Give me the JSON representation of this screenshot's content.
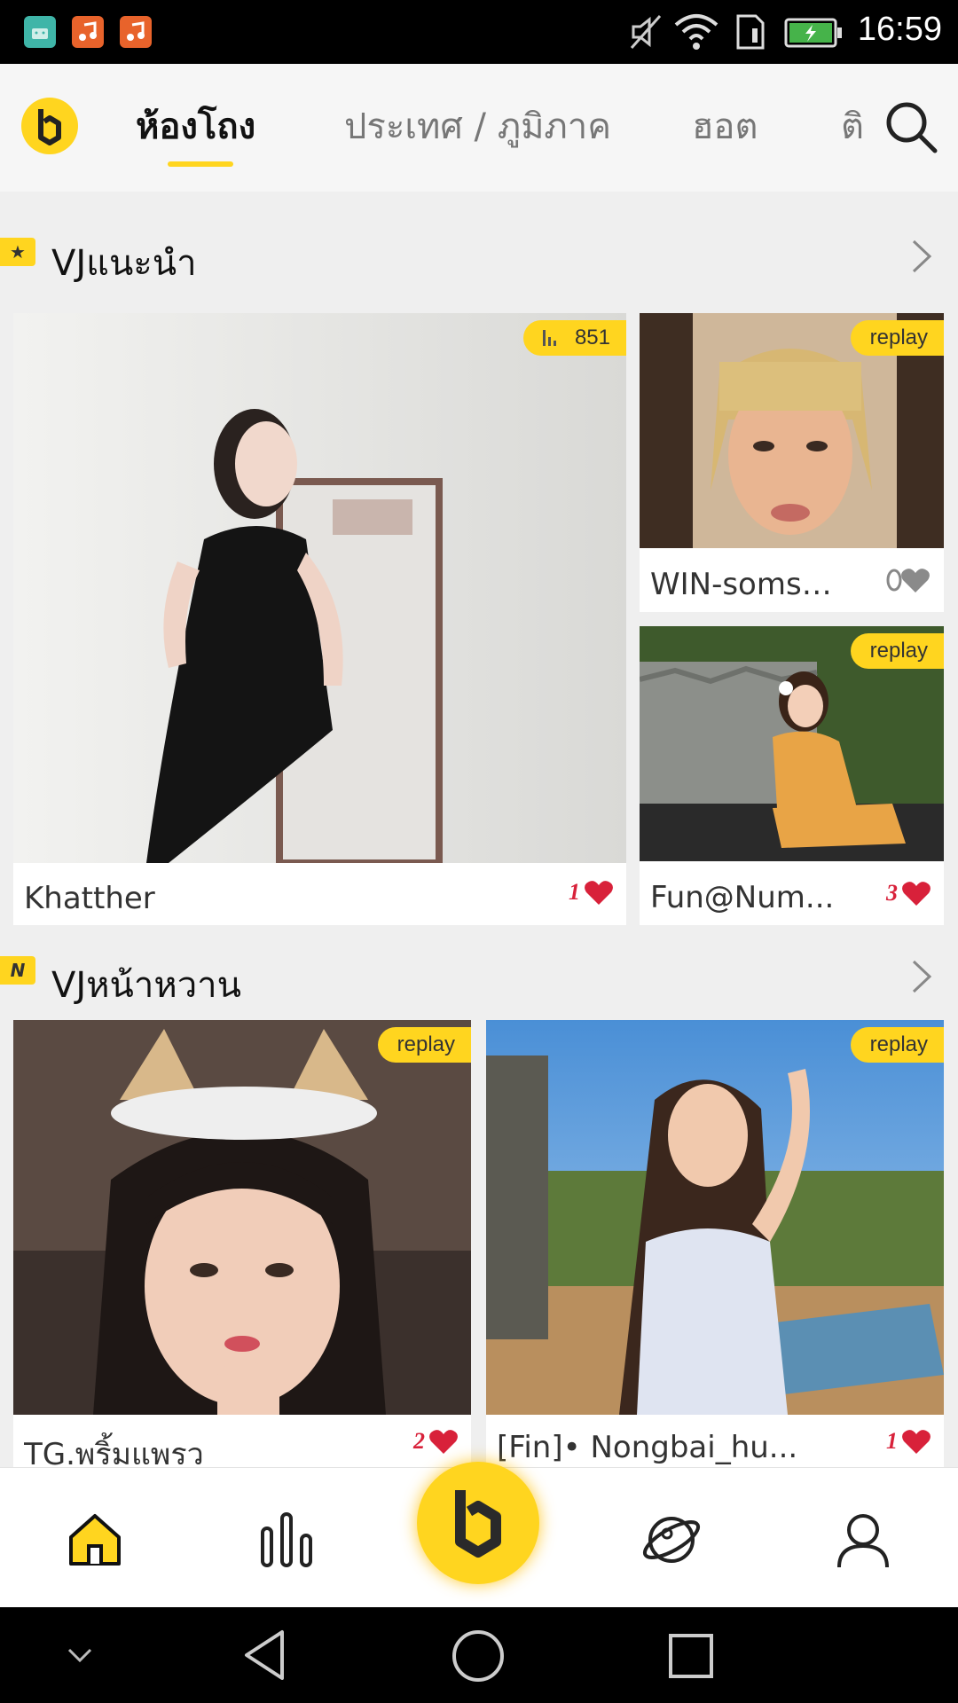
{
  "status_bar": {
    "time": "16:59",
    "app_icons": [
      "android-app-icon",
      "music-app-icon",
      "music-app-icon"
    ],
    "colors": {
      "android": "#3fb5a8",
      "music1": "#e8632b",
      "music2": "#e8632b"
    }
  },
  "top_nav": {
    "tabs": [
      {
        "label": "ห้องโถง",
        "active": true
      },
      {
        "label": "ประเทศ / ภูมิภาค",
        "active": false
      },
      {
        "label": "ฮอต",
        "active": false
      },
      {
        "label": "ติ",
        "active": false
      }
    ]
  },
  "sections": [
    {
      "title": "VJแนะนำ",
      "badge": "★",
      "cards": [
        {
          "name": "Khatther",
          "badge": "851",
          "badge_type": "live-viewers",
          "likes": "1"
        },
        {
          "name": "WIN-somso...",
          "badge": "replay",
          "badge_type": "replay",
          "likes": ""
        },
        {
          "name": "Fun@Num...",
          "badge": "replay",
          "badge_type": "replay",
          "likes": "3"
        }
      ]
    },
    {
      "title": "VJหน้าหวาน",
      "badge": "N",
      "cards": [
        {
          "name": "TG.พริ้มแพรว",
          "badge": "replay",
          "badge_type": "replay",
          "likes": "2"
        },
        {
          "name": "[Fin]• Nongbai_hu...",
          "badge": "replay",
          "badge_type": "replay",
          "likes": "1"
        }
      ]
    }
  ],
  "bottom_nav": {
    "items": [
      "home-icon",
      "ranking-icon",
      "live-center-icon",
      "planet-icon",
      "profile-icon"
    ]
  },
  "colors": {
    "accent": "#ffd51f",
    "heart": "#d8213a"
  }
}
